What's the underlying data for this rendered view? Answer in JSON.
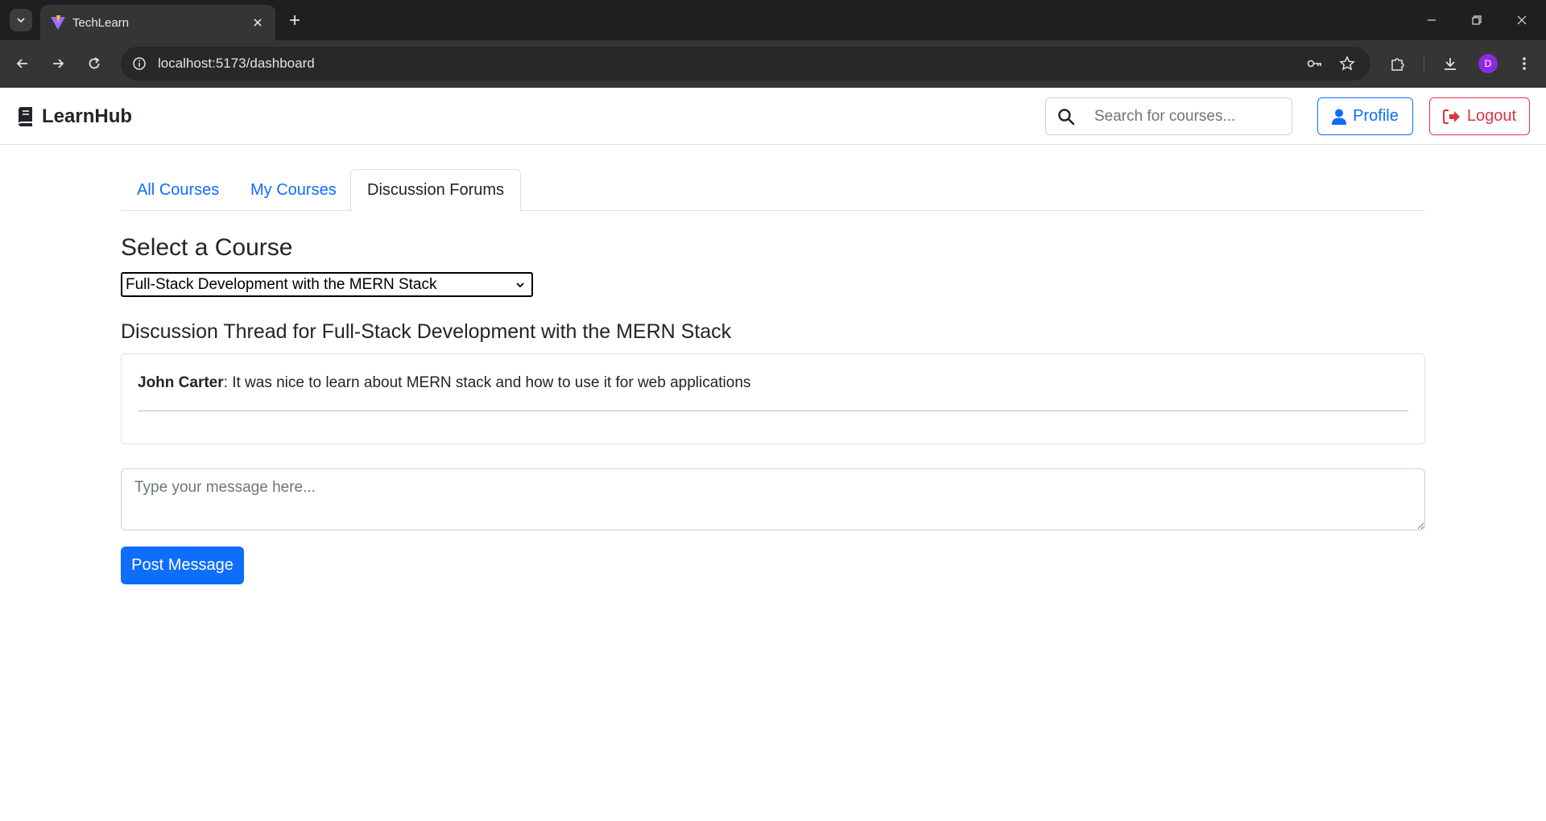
{
  "browser": {
    "tab_title": "TechLearn",
    "url": "localhost:5173/dashboard",
    "profile_initial": "D",
    "accent_color": "#8a2be2"
  },
  "navbar": {
    "brand": "LearnHub",
    "brand_icon": "book-icon",
    "search_placeholder": "Search for courses...",
    "profile_label": "Profile",
    "logout_label": "Logout",
    "primary_color": "#0d6efd",
    "danger_color": "#dc3545"
  },
  "tabs": [
    {
      "label": "All Courses",
      "active": false
    },
    {
      "label": "My Courses",
      "active": false
    },
    {
      "label": "Discussion Forums",
      "active": true
    }
  ],
  "course_section": {
    "title": "Select a Course",
    "selected_course": "Full-Stack Development with the MERN Stack"
  },
  "thread": {
    "title": "Discussion Thread for Full-Stack Development with the MERN Stack",
    "messages": [
      {
        "author": "John Carter",
        "text": ": It was nice to learn about MERN stack and how to use it for web applications"
      }
    ]
  },
  "composer": {
    "placeholder": "Type your message here...",
    "post_label": "Post Message"
  }
}
